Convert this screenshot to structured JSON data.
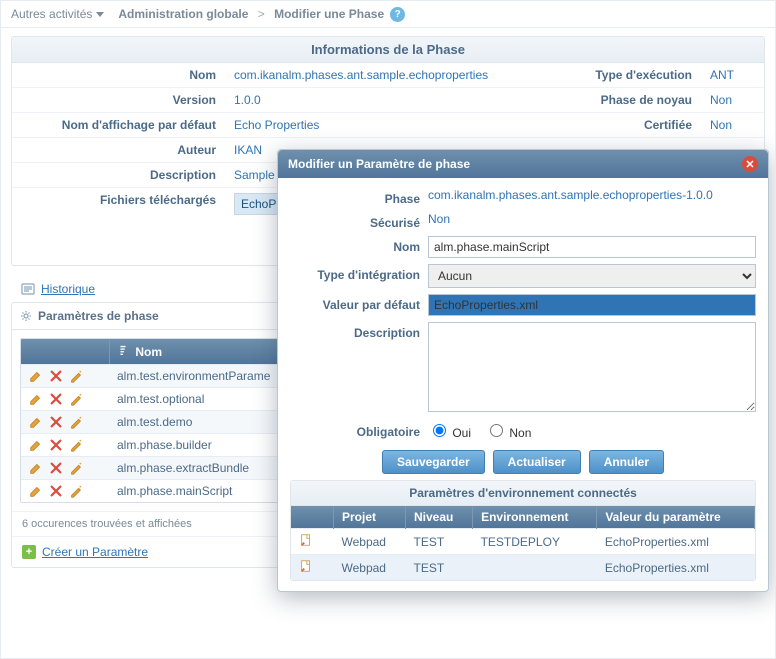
{
  "topbar": {
    "other_activities": "Autres activités",
    "crumb1": "Administration globale",
    "crumb2": "Modifier une Phase"
  },
  "phase_info": {
    "title": "Informations de la Phase",
    "labels": {
      "name": "Nom",
      "version": "Version",
      "display_name": "Nom d'affichage par défaut",
      "author": "Auteur",
      "description": "Description",
      "files": "Fichiers téléchargés",
      "exec_type": "Type d'exécution",
      "core_phase": "Phase de noyau",
      "certified": "Certifiée"
    },
    "values": {
      "name": "com.ikanalm.phases.ant.sample.echoproperties",
      "version": "1.0.0",
      "display_name": "Echo Properties",
      "author": "IKAN",
      "description": "Sample P",
      "file": "EchoPro",
      "exec_type": "ANT",
      "core_phase": "Non",
      "certified": "Non"
    }
  },
  "history_link": "Historique",
  "params": {
    "title": "Paramètres de phase",
    "name_header": "Nom",
    "rows": [
      "alm.test.environmentParame",
      "alm.test.optional",
      "alm.test.demo",
      "alm.phase.builder",
      "alm.phase.extractBundle",
      "alm.phase.mainScript"
    ],
    "footer": "6 occurences trouvées et affichées",
    "create": "Créer un Paramètre"
  },
  "modal": {
    "title": "Modifier un Paramètre de phase",
    "labels": {
      "phase": "Phase",
      "secured": "Sécurisé",
      "name": "Nom",
      "integration_type": "Type d'intégration",
      "default_value": "Valeur par défaut",
      "description": "Description",
      "mandatory": "Obligatoire"
    },
    "values": {
      "phase": "com.ikanalm.phases.ant.sample.echoproperties-1.0.0",
      "secured": "Non",
      "name": "alm.phase.mainScript",
      "integration_type": "Aucun",
      "default_value": "EchoProperties.xml",
      "description": "",
      "mandatory": "Oui"
    },
    "radio": {
      "yes": "Oui",
      "no": "Non"
    },
    "buttons": {
      "save": "Sauvegarder",
      "refresh": "Actualiser",
      "cancel": "Annuler"
    },
    "env": {
      "title": "Paramètres d'environnement connectés",
      "headers": {
        "project": "Projet",
        "level": "Niveau",
        "environment": "Environnement",
        "param_value": "Valeur du paramètre"
      },
      "rows": [
        {
          "project": "Webpad",
          "level": "TEST",
          "environment": "TESTDEPLOY",
          "param_value": "EchoProperties.xml"
        },
        {
          "project": "Webpad",
          "level": "TEST",
          "environment": "",
          "param_value": "EchoProperties.xml"
        }
      ]
    }
  }
}
